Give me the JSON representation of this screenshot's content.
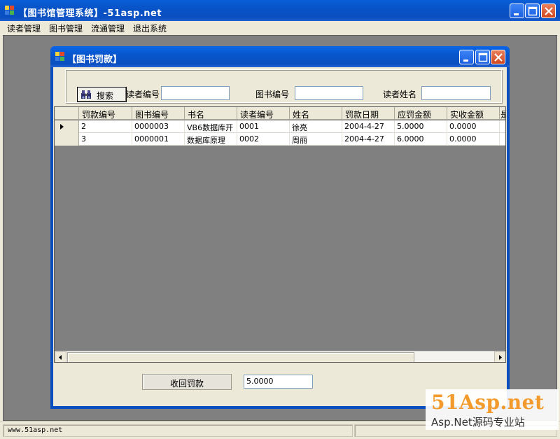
{
  "window": {
    "title": "【图书馆管理系统】-51asp.net"
  },
  "menu": {
    "items": [
      "读者管理",
      "图书管理",
      "流通管理",
      "退出系统"
    ]
  },
  "child_window": {
    "title": "【图书罚款】"
  },
  "search": {
    "button_label": "搜索",
    "reader_id_label": "读者编号",
    "reader_id_value": "",
    "book_id_label": "图书编号",
    "book_id_value": "",
    "reader_name_label": "读者姓名",
    "reader_name_value": ""
  },
  "grid": {
    "columns": [
      "罚款编号",
      "图书编号",
      "书名",
      "读者编号",
      "姓名",
      "罚款日期",
      "应罚金额",
      "实收金额",
      "是"
    ],
    "rows": [
      [
        "2",
        "0000003",
        "VB6数据库开",
        "0001",
        "徐亮",
        "2004-4-27",
        "5.0000",
        "0.0000",
        ""
      ],
      [
        "3",
        "0000001",
        "数据库原理",
        "0002",
        "周丽",
        "2004-4-27",
        "6.0000",
        "0.0000",
        ""
      ]
    ]
  },
  "actions": {
    "collect_label": "收回罚款",
    "amount_value": "5.0000"
  },
  "status": {
    "text": "www.51asp.net"
  },
  "watermark": {
    "logo": "51Asp.net",
    "subtitle": "Asp.Net源码专业站"
  }
}
